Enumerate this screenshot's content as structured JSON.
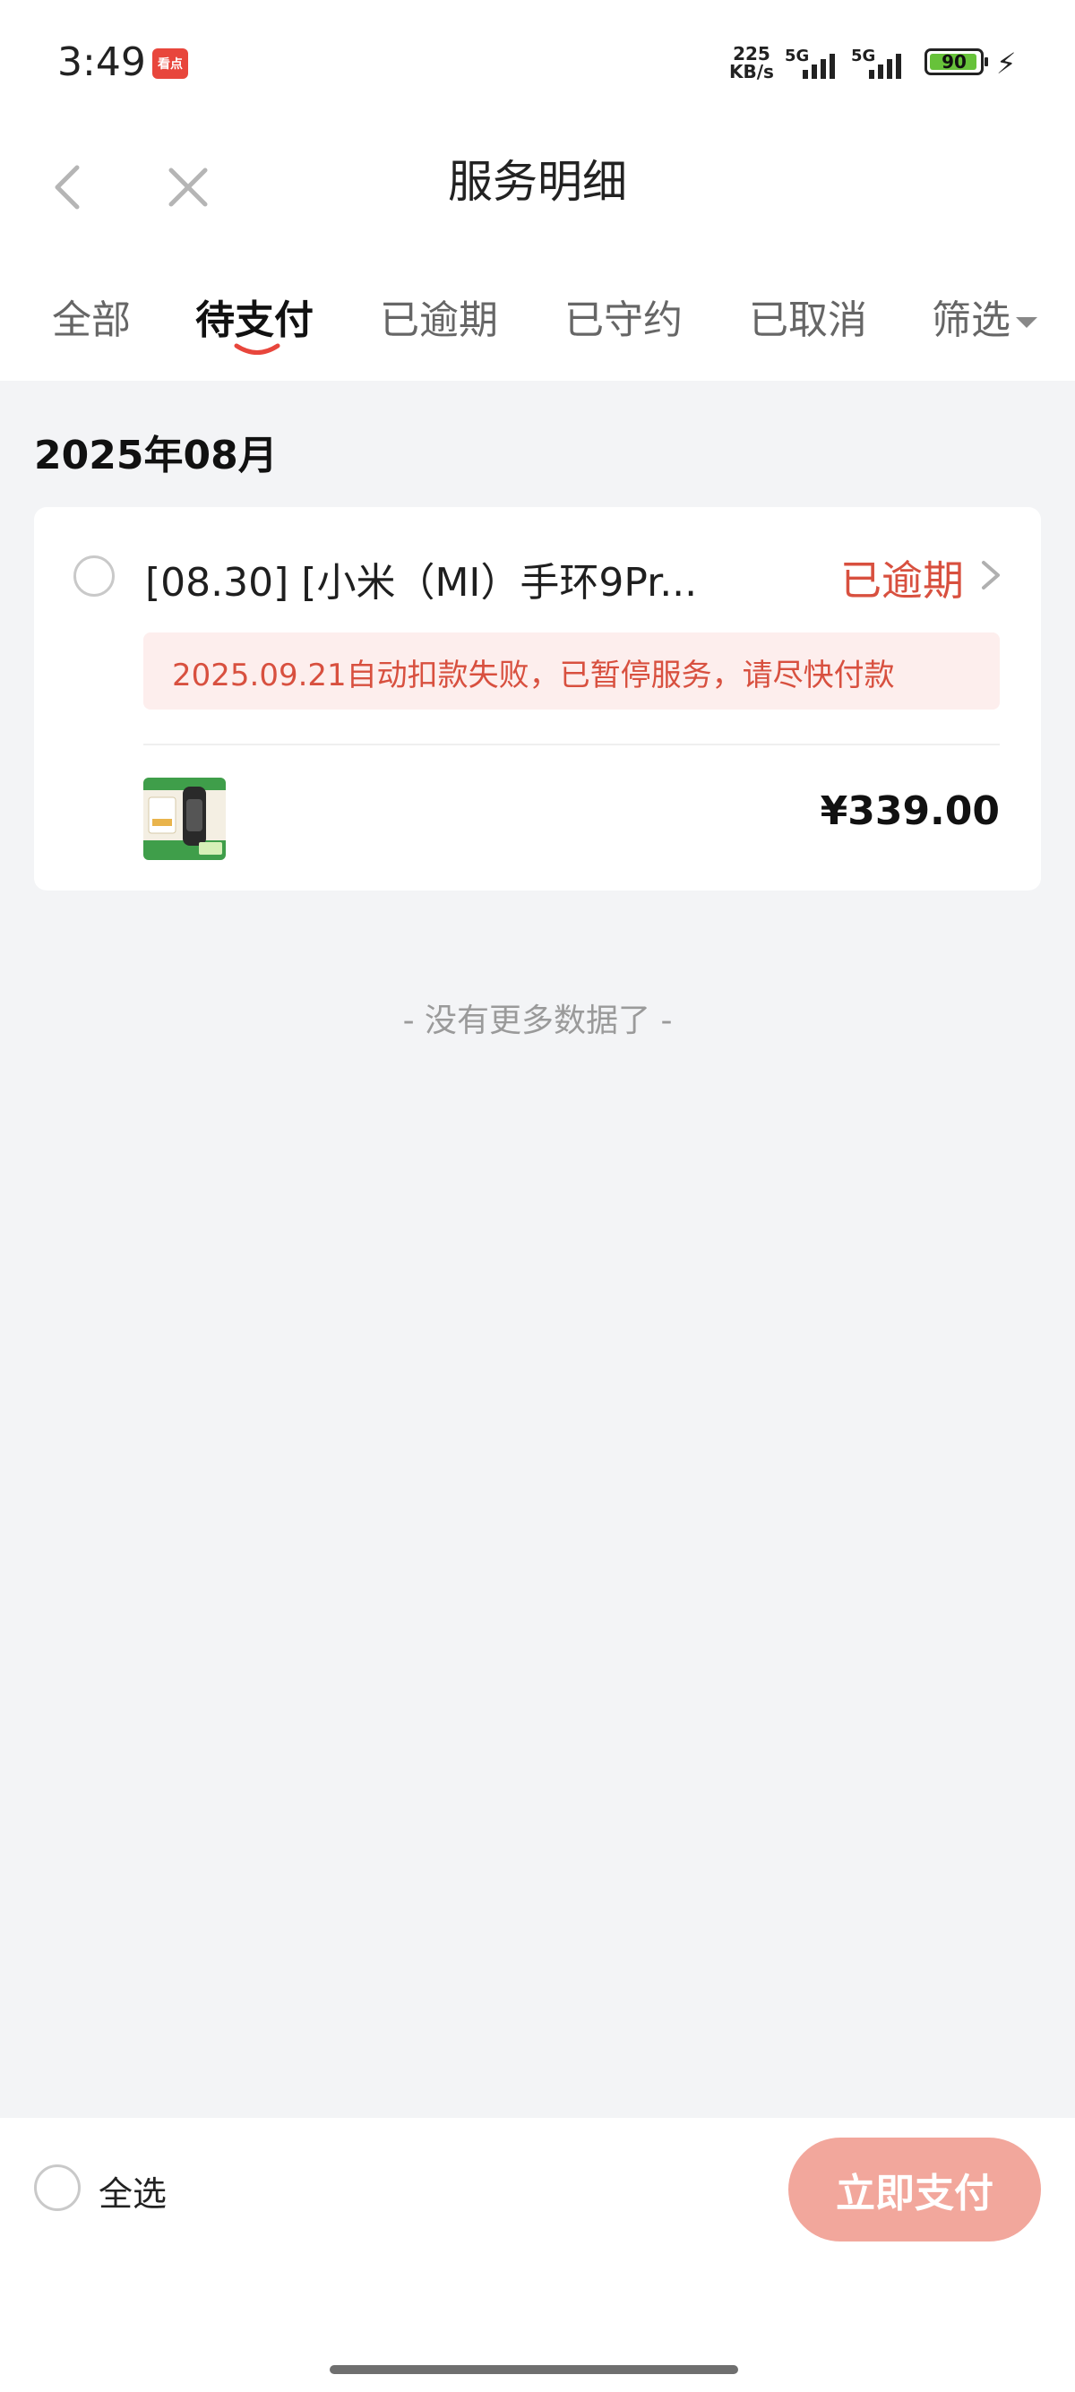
{
  "status_bar": {
    "time": "3:49",
    "app_badge": "看点",
    "net_speed_value": "225",
    "net_speed_unit": "KB/s",
    "signal1_label": "5G",
    "signal2_label": "5G",
    "battery": "90"
  },
  "header": {
    "title": "服务明细",
    "back_icon": "chevron-left-icon",
    "close_icon": "close-icon"
  },
  "tabs": [
    {
      "label": "全部"
    },
    {
      "label": "待支付"
    },
    {
      "label": "已逾期"
    },
    {
      "label": "已守约"
    },
    {
      "label": "已取消"
    },
    {
      "label": "筛选"
    }
  ],
  "active_tab_index": 1,
  "month_header": "2025年08月",
  "order": {
    "title": "[08.30] [小米（MI）手环9Pr...",
    "status": "已逾期",
    "alert": "2025.09.21自动扣款失败，已暂停服务，请尽快付款",
    "price": "¥339.00"
  },
  "list_end_text": "- 没有更多数据了 -",
  "bottom_bar": {
    "select_all_label": "全选",
    "pay_button_label": "立即支付"
  },
  "colors": {
    "accent": "#d8503f",
    "alert_bg": "#fdeeed",
    "pay_button": "#f2a79c"
  }
}
